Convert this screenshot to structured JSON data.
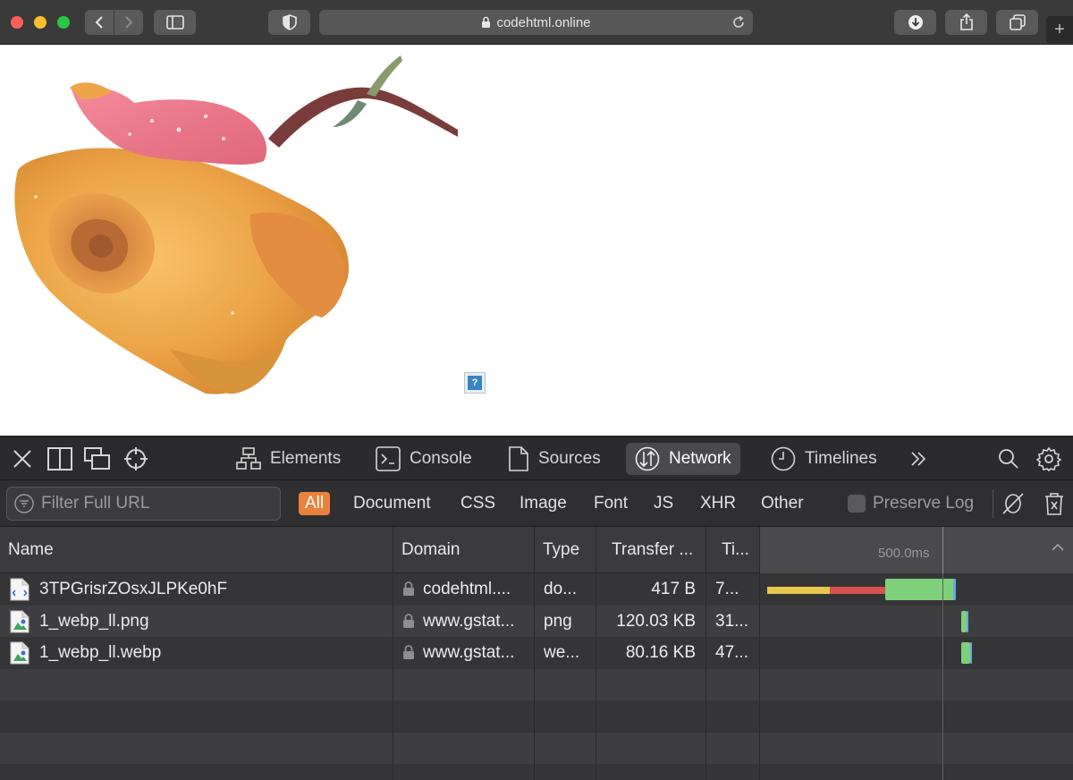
{
  "browser": {
    "url": "codehtml.online"
  },
  "devtools": {
    "tabs": [
      {
        "label": "Elements"
      },
      {
        "label": "Console"
      },
      {
        "label": "Sources"
      },
      {
        "label": "Network"
      },
      {
        "label": "Timelines"
      }
    ],
    "active_tab": "Network",
    "filter": {
      "placeholder": "Filter Full URL",
      "types": [
        "All",
        "Document",
        "CSS",
        "Image",
        "Font",
        "JS",
        "XHR",
        "Other"
      ],
      "active_type": "All",
      "preserve_log_label": "Preserve Log"
    },
    "table": {
      "columns": [
        "Name",
        "Domain",
        "Type",
        "Transfer ...",
        "Ti..."
      ],
      "waterfall_label": "500.0ms",
      "rows": [
        {
          "name": "3TPGrisrZOsxJLPKe0hF",
          "domain": "codehtml....",
          "type": "do...",
          "transfer": "417 B",
          "time": "7..."
        },
        {
          "name": "1_webp_ll.png",
          "domain": "www.gstat...",
          "type": "png",
          "transfer": "120.03 KB",
          "time": "31..."
        },
        {
          "name": "1_webp_ll.webp",
          "domain": "www.gstat...",
          "type": "we...",
          "transfer": "80.16 KB",
          "time": "47..."
        }
      ]
    }
  },
  "colors": {
    "accent": "#e8823b",
    "waterfall_wait": "#e8c84a",
    "waterfall_connect": "#d8504f",
    "waterfall_receive": "#7fd07a",
    "waterfall_end": "#6aa8e0"
  }
}
